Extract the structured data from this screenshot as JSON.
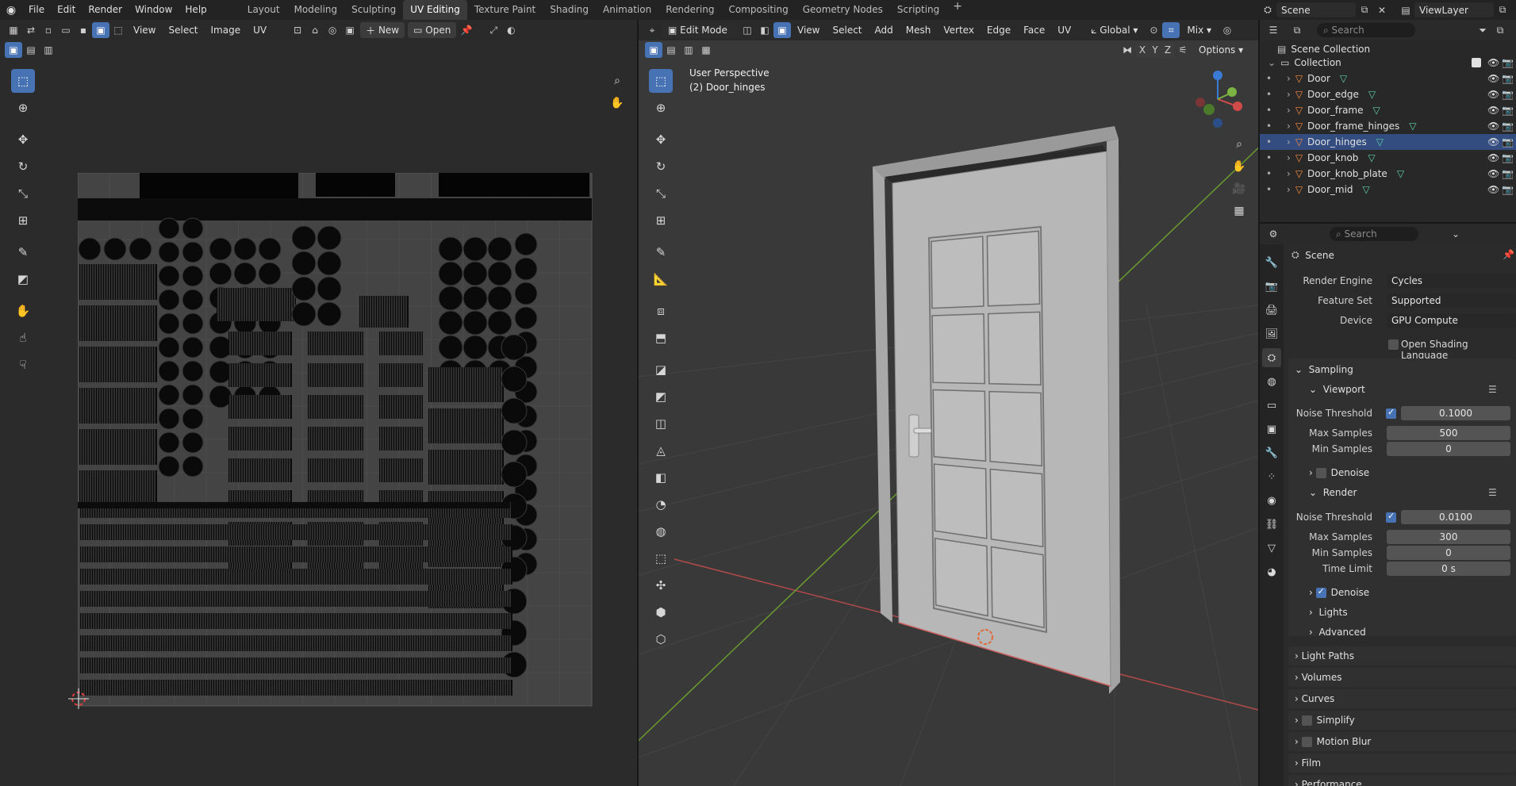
{
  "topbar": {
    "menus": [
      "File",
      "Edit",
      "Render",
      "Window",
      "Help"
    ],
    "workspaces": [
      "Layout",
      "Modeling",
      "Sculpting",
      "UV Editing",
      "Texture Paint",
      "Shading",
      "Animation",
      "Rendering",
      "Compositing",
      "Geometry Nodes",
      "Scripting"
    ],
    "active_workspace": "UV Editing",
    "add_tab": "+",
    "scene": "Scene",
    "view_layer": "ViewLayer"
  },
  "uv_editor": {
    "menus": [
      "View",
      "Select",
      "Image",
      "UV"
    ],
    "new_label": "New",
    "open_label": "Open"
  },
  "viewport": {
    "mode": "Edit Mode",
    "menus": [
      "View",
      "Select",
      "Add",
      "Mesh",
      "Vertex",
      "Edge",
      "Face",
      "UV"
    ],
    "orientation": "Global",
    "shading_mix": "Mix",
    "options": "Options",
    "axis_labels": [
      "X",
      "Y",
      "Z"
    ],
    "perspective": "User Perspective",
    "object_info": "(2) Door_hinges"
  },
  "outliner": {
    "search_placeholder": "Search",
    "root": "Scene Collection",
    "collection": "Collection",
    "items": [
      {
        "name": "Door",
        "selected": false
      },
      {
        "name": "Door_edge",
        "selected": false
      },
      {
        "name": "Door_frame",
        "selected": false
      },
      {
        "name": "Door_frame_hinges",
        "selected": false
      },
      {
        "name": "Door_hinges",
        "selected": true
      },
      {
        "name": "Door_knob",
        "selected": false
      },
      {
        "name": "Door_knob_plate",
        "selected": false
      },
      {
        "name": "Door_mid",
        "selected": false
      }
    ]
  },
  "properties": {
    "search_placeholder": "Search",
    "context": "Scene",
    "render_engine_label": "Render Engine",
    "render_engine": "Cycles",
    "feature_set_label": "Feature Set",
    "feature_set": "Supported",
    "device_label": "Device",
    "device": "GPU Compute",
    "osl_label": "Open Shading Language",
    "sampling": "Sampling",
    "viewport": "Viewport",
    "noise_threshold_label": "Noise Threshold",
    "vp_noise": "0.1000",
    "max_samples_label": "Max Samples",
    "vp_max": "500",
    "min_samples_label": "Min Samples",
    "vp_min": "0",
    "denoise_label": "Denoise",
    "render": "Render",
    "r_noise": "0.0100",
    "r_max": "300",
    "r_min": "0",
    "time_limit_label": "Time Limit",
    "time_limit": "0 s",
    "lights": "Lights",
    "advanced": "Advanced",
    "sections": [
      "Light Paths",
      "Volumes",
      "Curves",
      "Simplify",
      "Motion Blur",
      "Film",
      "Performance"
    ]
  },
  "colors": {
    "accent": "#4772b3",
    "selected_row": "#334d80",
    "mesh_icon": "#ff8c3a",
    "data_icon": "#5fd3a8"
  }
}
